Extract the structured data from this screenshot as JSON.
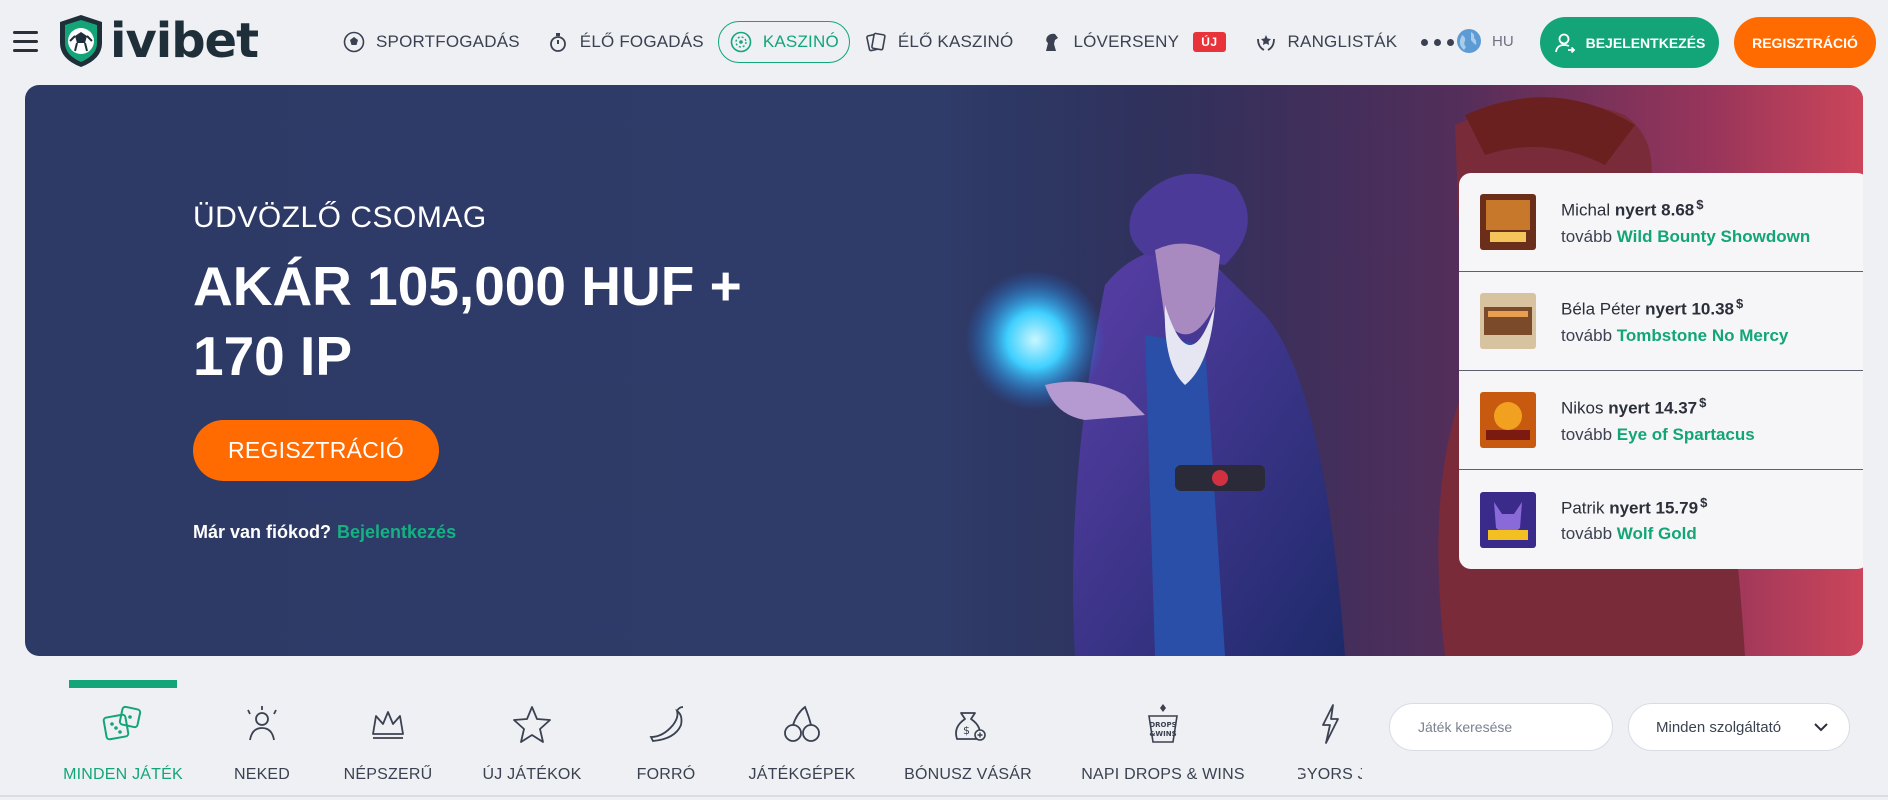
{
  "header": {
    "logo_text": "ivibet",
    "nav": [
      {
        "label": "SPORTFOGADÁS",
        "icon": "soccer-ball-icon"
      },
      {
        "label": "ÉLŐ FOGADÁS",
        "icon": "stopwatch-icon"
      },
      {
        "label": "KASZINÓ",
        "icon": "roulette-icon",
        "active": true
      },
      {
        "label": "ÉLŐ KASZINÓ",
        "icon": "cards-icon"
      },
      {
        "label": "LÓVERSENY",
        "icon": "horse-icon"
      },
      {
        "label": "RANGLISTÁK",
        "icon": "laurel-icon"
      }
    ],
    "new_badge": "ÚJ",
    "lang": "HU",
    "login_label": "BEJELENTKEZÉS",
    "register_label": "REGISZTRÁCIÓ"
  },
  "hero": {
    "subtitle": "ÜDVÖZLŐ CSOMAG",
    "title_line1": "AKÁR 105,000 HUF +",
    "title_line2": "170 IP",
    "cta_label": "REGISZTRÁCIÓ",
    "have_account": "Már van fiókod?",
    "login_link": "Bejelentkezés"
  },
  "winners": [
    {
      "name": "Michal",
      "won": "nyert",
      "amount": "8.68",
      "currency": "$",
      "more": "tovább",
      "game": "Wild Bounty Showdown"
    },
    {
      "name": "Béla Péter",
      "won": "nyert",
      "amount": "10.38",
      "currency": "$",
      "more": "tovább",
      "game": "Tombstone No Mercy"
    },
    {
      "name": "Nikos",
      "won": "nyert",
      "amount": "14.37",
      "currency": "$",
      "more": "tovább",
      "game": "Eye of Spartacus"
    },
    {
      "name": "Patrik",
      "won": "nyert",
      "amount": "15.79",
      "currency": "$",
      "more": "tovább",
      "game": "Wolf Gold"
    }
  ],
  "categories": [
    {
      "label": "MINDEN JÁTÉK",
      "icon": "dice-icon",
      "active": true
    },
    {
      "label": "NEKED",
      "icon": "user-star-icon"
    },
    {
      "label": "NÉPSZERŰ",
      "icon": "crown-icon"
    },
    {
      "label": "ÚJ JÁTÉKOK",
      "icon": "star-icon"
    },
    {
      "label": "FORRÓ",
      "icon": "chili-icon"
    },
    {
      "label": "JÁTÉKGÉPEK",
      "icon": "cherry-icon"
    },
    {
      "label": "BÓNUSZ VÁSÁR",
      "icon": "money-bag-icon"
    },
    {
      "label": "NAPI DROPS & WINS",
      "icon": "drops-wins-icon"
    },
    {
      "label": "GYORS J",
      "icon": "lightning-icon"
    }
  ],
  "search": {
    "placeholder": "Játék keresése"
  },
  "provider": {
    "selected": "Minden szolgáltató"
  },
  "colors": {
    "brand_green": "#13a578",
    "orange": "#ff6b00",
    "hero_blue": "#2e3a66",
    "badge_red": "#e8333a"
  }
}
